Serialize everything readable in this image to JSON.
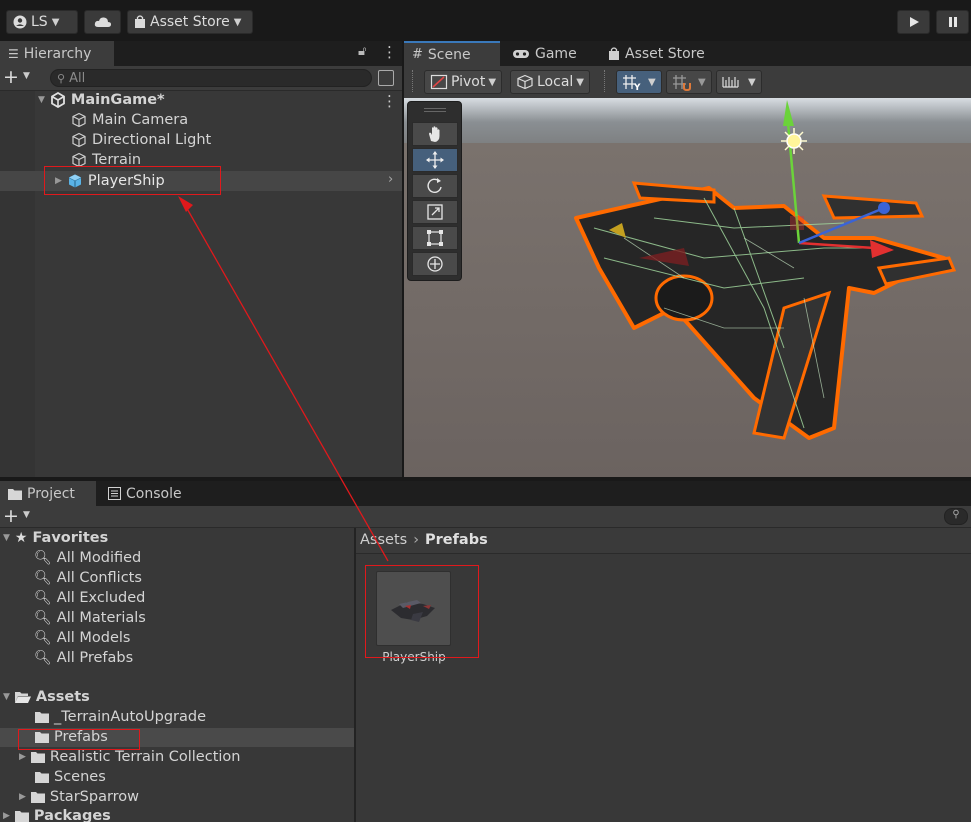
{
  "toolbar": {
    "account_label": "LS",
    "asset_store_label": "Asset Store"
  },
  "hierarchy": {
    "tab_label": "Hierarchy",
    "search_placeholder": "All",
    "scene_name": "MainGame*",
    "items": [
      {
        "label": "Main Camera"
      },
      {
        "label": "Directional Light"
      },
      {
        "label": "Terrain"
      },
      {
        "label": "PlayerShip"
      }
    ]
  },
  "scene": {
    "tabs": [
      {
        "label": "Scene"
      },
      {
        "label": "Game"
      },
      {
        "label": "Asset Store"
      }
    ],
    "pivot_label": "Pivot",
    "local_label": "Local"
  },
  "project": {
    "tabs": [
      {
        "label": "Project"
      },
      {
        "label": "Console"
      }
    ],
    "favorites_label": "Favorites",
    "favorites": [
      {
        "label": "All Modified"
      },
      {
        "label": "All Conflicts"
      },
      {
        "label": "All Excluded"
      },
      {
        "label": "All Materials"
      },
      {
        "label": "All Models"
      },
      {
        "label": "All Prefabs"
      }
    ],
    "assets_label": "Assets",
    "assets": [
      {
        "label": "_TerrainAutoUpgrade"
      },
      {
        "label": "Prefabs"
      },
      {
        "label": "Realistic Terrain Collection"
      },
      {
        "label": "Scenes"
      },
      {
        "label": "StarSparrow"
      }
    ],
    "packages_label": "Packages",
    "breadcrumb_root": "Assets",
    "breadcrumb_current": "Prefabs",
    "asset_item_label": "PlayerShip"
  },
  "colors": {
    "accent_blue": "#3a79bb",
    "annotation_red": "#e0191c",
    "selection_orange": "#ff6a00"
  }
}
